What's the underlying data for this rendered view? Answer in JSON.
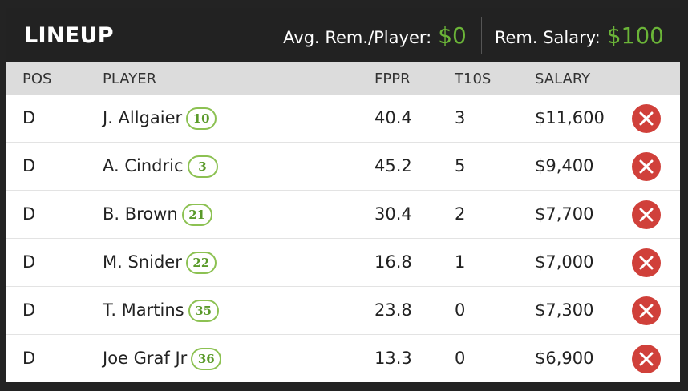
{
  "header": {
    "title": "LINEUP",
    "avg_label": "Avg. Rem./Player:",
    "avg_value": "$0",
    "salary_label": "Rem. Salary:",
    "salary_value": "$100"
  },
  "columns": {
    "pos": "POS",
    "player": "PLAYER",
    "fppr": "FPPR",
    "t10s": "T10S",
    "salary": "SALARY"
  },
  "colors": {
    "accent": "#6bb538",
    "remove": "#d0403a",
    "badge_border": "#8cc152",
    "header_bg": "#222222"
  },
  "rows": [
    {
      "pos": "D",
      "player": "J. Allgaier",
      "number": "10",
      "fppr": "40.4",
      "t10s": "3",
      "salary": "$11,600",
      "action_icon": "remove-icon"
    },
    {
      "pos": "D",
      "player": "A. Cindric",
      "number": "3",
      "fppr": "45.2",
      "t10s": "5",
      "salary": "$9,400",
      "action_icon": "remove-icon"
    },
    {
      "pos": "D",
      "player": "B. Brown",
      "number": "21",
      "fppr": "30.4",
      "t10s": "2",
      "salary": "$7,700",
      "action_icon": "remove-icon"
    },
    {
      "pos": "D",
      "player": "M. Snider",
      "number": "22",
      "fppr": "16.8",
      "t10s": "1",
      "salary": "$7,000",
      "action_icon": "remove-icon"
    },
    {
      "pos": "D",
      "player": "T. Martins",
      "number": "35",
      "fppr": "23.8",
      "t10s": "0",
      "salary": "$7,300",
      "action_icon": "remove-icon"
    },
    {
      "pos": "D",
      "player": "Joe Graf Jr",
      "number": "36",
      "fppr": "13.3",
      "t10s": "0",
      "salary": "$6,900",
      "action_icon": "remove-icon"
    }
  ]
}
